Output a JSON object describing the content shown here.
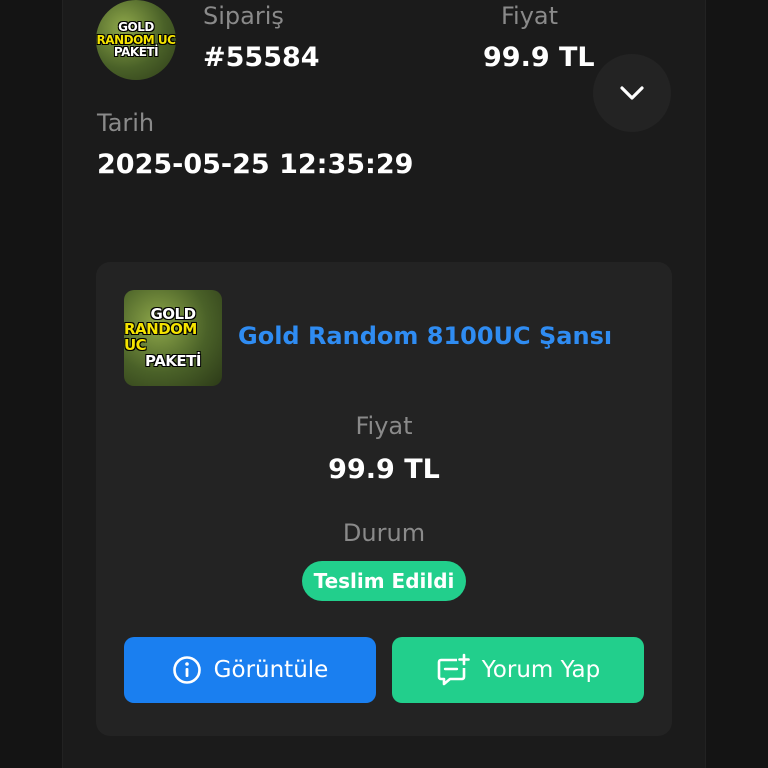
{
  "order": {
    "label_order": "Sipariş",
    "order_number": "#55584",
    "label_price": "Fiyat",
    "price": "99.9 TL",
    "label_date": "Tarih",
    "date": "2025-05-25 12:35:29",
    "thumbnail_text": [
      "GOLD",
      "RANDOM UC",
      "PAKETİ"
    ]
  },
  "product": {
    "title": "Gold Random 8100UC Şansı",
    "label_price": "Fiyat",
    "price": "99.9 TL",
    "label_status": "Durum",
    "status": "Teslim Edildi",
    "status_color": "#22cf8c",
    "thumbnail_text": [
      "GOLD",
      "RANDOM UC",
      "PAKETİ"
    ]
  },
  "actions": {
    "view_label": "Görüntüle",
    "view_icon": "info-icon",
    "view_color": "#1a7ff0",
    "review_label": "Yorum Yap",
    "review_icon": "add-comment-icon",
    "review_color": "#22cf8c"
  },
  "toggle": {
    "icon": "chevron-down-icon"
  }
}
